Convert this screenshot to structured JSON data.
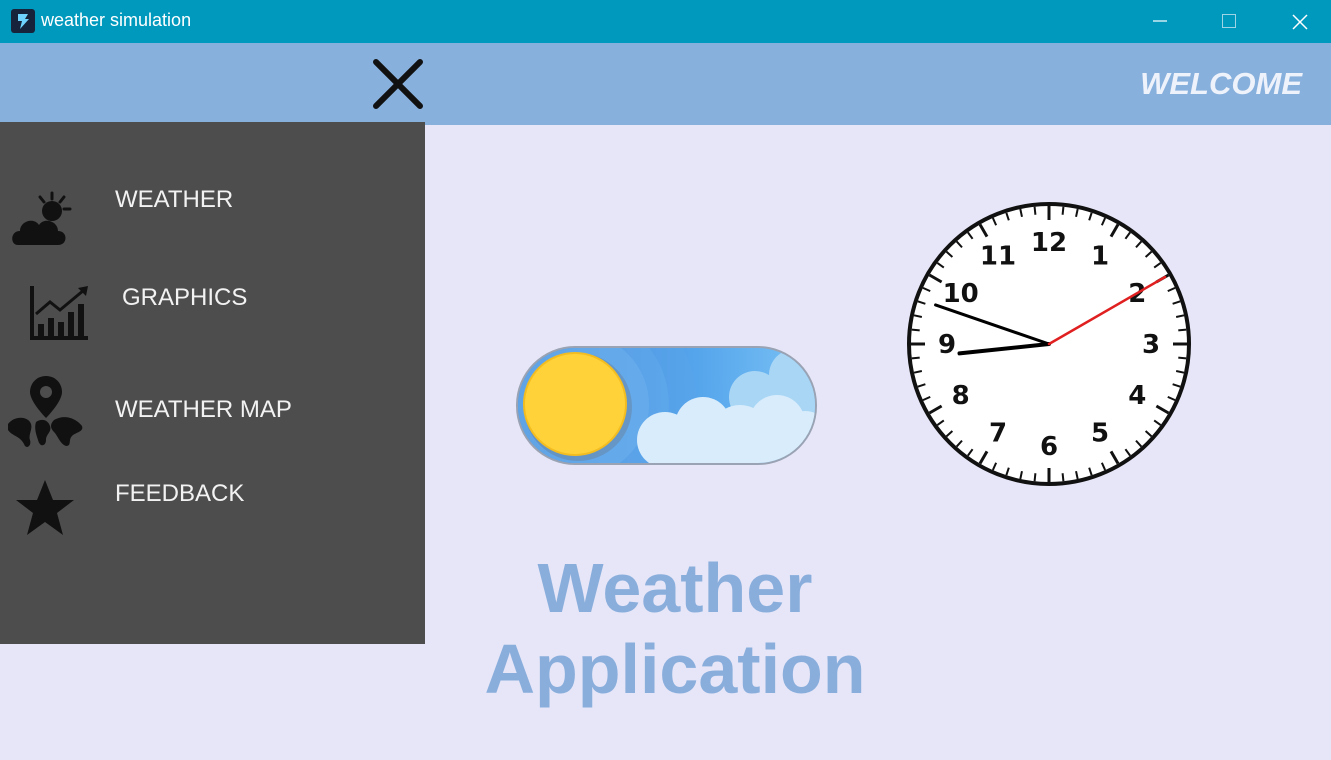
{
  "window": {
    "title": "weather simulation",
    "app_icon": "weather-app-icon",
    "controls": [
      "minimize-icon",
      "maximize-icon",
      "close-icon"
    ]
  },
  "header": {
    "welcome": "WELCOME",
    "menu_toggle_icon": "close-icon"
  },
  "sidebar": {
    "items": [
      {
        "label": "WEATHER",
        "icon": "weather-cloud-sun-icon"
      },
      {
        "label": "GRAPHICS",
        "icon": "bar-chart-trend-icon"
      },
      {
        "label": "WEATHER MAP",
        "icon": "world-map-pin-icon"
      },
      {
        "label": "FEEDBACK",
        "icon": "star-icon"
      }
    ]
  },
  "main": {
    "theme_toggle": {
      "state": "day",
      "icon": "sun-icon"
    },
    "clock": {
      "numbers": [
        "12",
        "1",
        "2",
        "3",
        "4",
        "5",
        "6",
        "7",
        "8",
        "9",
        "10",
        "11"
      ],
      "time": {
        "hour": 8,
        "minute": 48,
        "second": 10
      }
    },
    "brand_line1": "Weather",
    "brand_line2": "Application"
  },
  "colors": {
    "titlebar": "#0099be",
    "header": "#88b0dc",
    "sidebar": "#4d4d4d",
    "background": "#e6e6f8",
    "brand_text": "#8aaedc",
    "second_hand": "#e02020",
    "sun": "#ffd23a"
  }
}
